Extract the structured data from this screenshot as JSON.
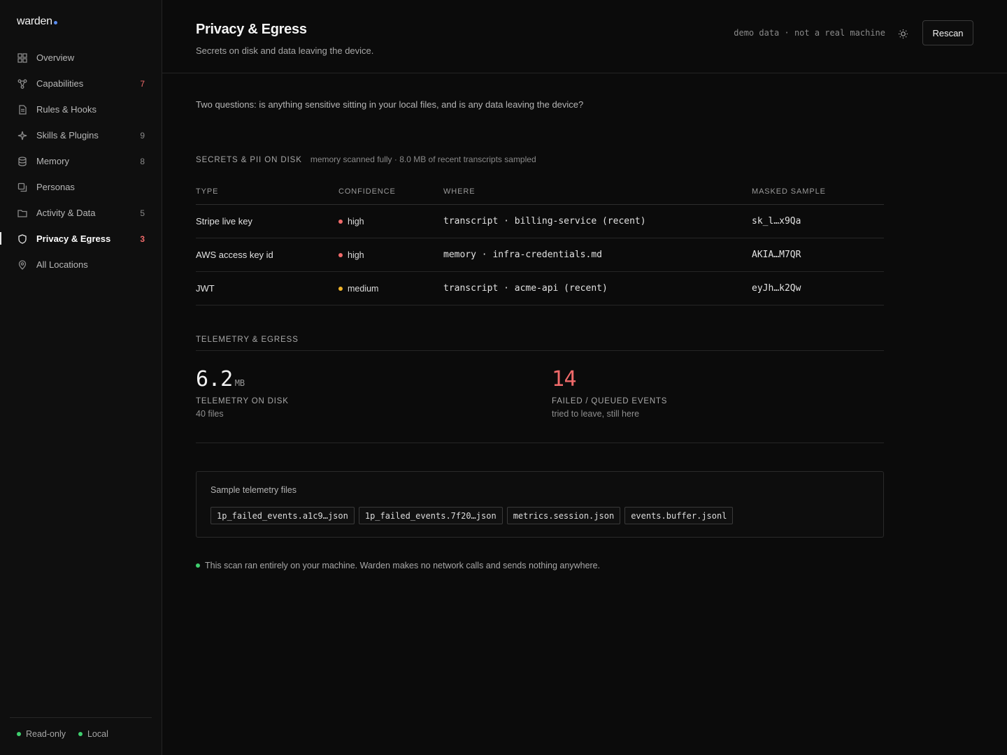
{
  "brand": {
    "name": "warden",
    "accent": "#5b8def"
  },
  "sidebar": {
    "items": [
      {
        "label": "Overview",
        "badge": "",
        "icon": "grid-icon",
        "active": false
      },
      {
        "label": "Capabilities",
        "badge": "7",
        "icon": "branch-icon",
        "active": false,
        "badge_alert": true
      },
      {
        "label": "Rules & Hooks",
        "badge": "",
        "icon": "document-icon",
        "active": false
      },
      {
        "label": "Skills & Plugins",
        "badge": "9",
        "icon": "sparkle-icon",
        "active": false
      },
      {
        "label": "Memory",
        "badge": "8",
        "icon": "database-icon",
        "active": false
      },
      {
        "label": "Personas",
        "badge": "",
        "icon": "persona-icon",
        "active": false
      },
      {
        "label": "Activity & Data",
        "badge": "5",
        "icon": "folder-icon",
        "active": false
      },
      {
        "label": "Privacy & Egress",
        "badge": "3",
        "icon": "shield-icon",
        "active": true,
        "badge_alert": true
      },
      {
        "label": "All Locations",
        "badge": "",
        "icon": "location-pin-icon",
        "active": false
      }
    ],
    "footer": {
      "readonly": "Read-only",
      "local": "Local"
    }
  },
  "header": {
    "title": "Privacy & Egress",
    "subtitle": "Secrets on disk and data leaving the device.",
    "demo_note": "demo data · not a real machine",
    "rescan_label": "Rescan"
  },
  "intro": "Two questions: is anything sensitive sitting in your local files, and is any data leaving the device?",
  "secrets": {
    "title": "Secrets & PII on disk",
    "note": "memory scanned fully · 8.0 MB of recent transcripts sampled",
    "columns": {
      "type": "Type",
      "confidence": "Confidence",
      "where": "Where",
      "sample": "Masked sample"
    },
    "rows": [
      {
        "type": "Stripe live key",
        "confidence": "high",
        "where": "transcript · billing-service (recent)",
        "sample": "sk_l…x9Qa",
        "color": "#f06a6a"
      },
      {
        "type": "AWS access key id",
        "confidence": "high",
        "where": "memory · infra-credentials.md",
        "sample": "AKIA…M7QR",
        "color": "#f06a6a"
      },
      {
        "type": "JWT",
        "confidence": "medium",
        "where": "transcript · acme-api (recent)",
        "sample": "eyJh…k2Qw",
        "color": "#f0b429"
      }
    ]
  },
  "telemetry": {
    "title": "Telemetry & Egress",
    "disk": {
      "value": "6.2",
      "unit": "MB",
      "label": "Telemetry on disk",
      "sub": "40 files"
    },
    "failed": {
      "value": "14",
      "label": "Failed / queued events",
      "sub": "tried to leave, still here",
      "color": "#f06a6a"
    }
  },
  "files": {
    "title": "Sample telemetry files",
    "items": [
      "1p_failed_events.a1c9…json",
      "1p_failed_events.7f20…json",
      "metrics.session.json",
      "events.buffer.jsonl"
    ]
  },
  "footer_note": "This scan ran entirely on your machine. Warden makes no network calls and sends nothing anywhere.",
  "colors": {
    "ok": "#3fcf6e",
    "alert": "#f06a6a",
    "warn": "#f0b429"
  }
}
